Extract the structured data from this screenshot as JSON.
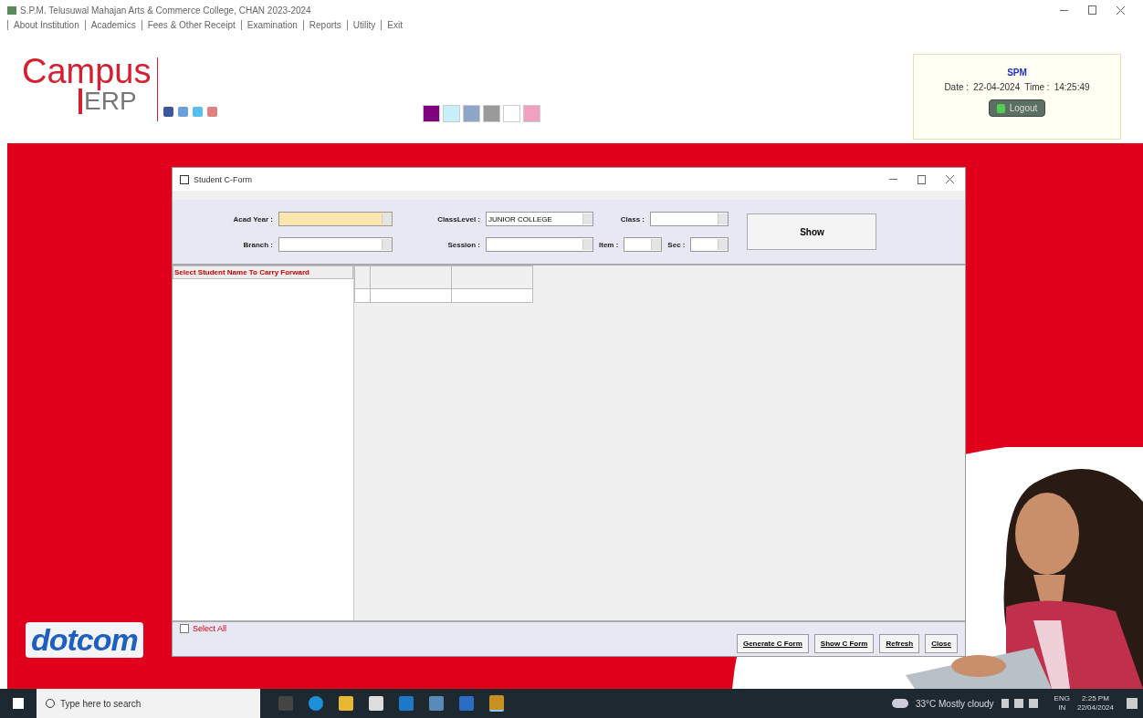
{
  "window": {
    "title": "S.P.M. Telusuwal Mahajan Arts & Commerce College, CHAN 2023-2024"
  },
  "menu": [
    "About Institution",
    "Academics",
    "Fees & Other Receipt",
    "Examination",
    "Reports",
    "Utility",
    "Exit"
  ],
  "logo": {
    "top": "Campus",
    "bottom": "ERP"
  },
  "social_icons": [
    {
      "color": "#3b5998"
    },
    {
      "color": "#6aa0d8"
    },
    {
      "color": "#55c0ee"
    },
    {
      "color": "#e08080"
    }
  ],
  "theme_swatches": [
    {
      "color": "#800080"
    },
    {
      "color": "#c8f0fa"
    },
    {
      "color": "#8fa6c8"
    },
    {
      "color": "#9a9a9a"
    },
    {
      "color": "#ffffff"
    },
    {
      "color": "#f0a0c0"
    }
  ],
  "user_panel": {
    "user": "SPM",
    "date_label": "Date :",
    "date": "22-04-2024",
    "time_label": "Time :",
    "time": "14:25:49",
    "logout": "Logout"
  },
  "form": {
    "title": "Student C-Form",
    "filters": [
      {
        "label": "Acad Year :",
        "highlight": true
      },
      {
        "label": "ClassLevel :",
        "value": "JUNIOR COLLEGE",
        "highlight": false
      },
      {
        "label": "Class :",
        "highlight": false
      },
      {
        "label": "Branch :",
        "highlight": false
      },
      {
        "label": "Session :",
        "highlight": false
      }
    ],
    "small_filters": [
      {
        "label": "Item :"
      },
      {
        "label": "Sec :"
      }
    ],
    "show_button": "Show",
    "list_header": "Select Student Name To Carry Forward",
    "select_all": {
      "label": "Select All",
      "checked": false
    },
    "buttons": [
      "Generate C Form",
      "Show C Form",
      "Refresh",
      "Close"
    ]
  },
  "brand": "dotcom",
  "taskbar": {
    "search_placeholder": "Type here to search",
    "weather": "33°C  Mostly cloudy",
    "language": "ENG",
    "region": "IN",
    "time": "2:25 PM",
    "date": "22/04/2024"
  }
}
